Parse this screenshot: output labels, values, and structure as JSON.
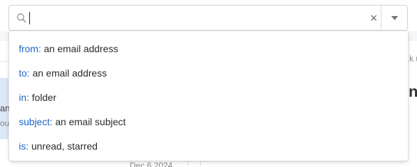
{
  "search": {
    "value": "",
    "placeholder": "",
    "clear_label": "×"
  },
  "suggestions": [
    {
      "key": "from:",
      "desc": "an email address"
    },
    {
      "key": "to:",
      "desc": "an email address"
    },
    {
      "key": "in:",
      "desc": "folder"
    },
    {
      "key": "subject:",
      "desc": "an email subject"
    },
    {
      "key": "is:",
      "desc": "unread, starred"
    }
  ],
  "background": {
    "left_fragment_1": "an",
    "left_fragment_2": "ou",
    "right_fragment_top": "k u",
    "right_fragment_big": "na",
    "date_fragment": "Dec 6 2024"
  },
  "colors": {
    "accent": "#1a66c9",
    "border": "#cfd3d8",
    "selected_row": "#dce7f7"
  },
  "icons": {
    "search": "search-icon",
    "clear": "close-icon",
    "dropdown": "chevron-down-icon"
  }
}
